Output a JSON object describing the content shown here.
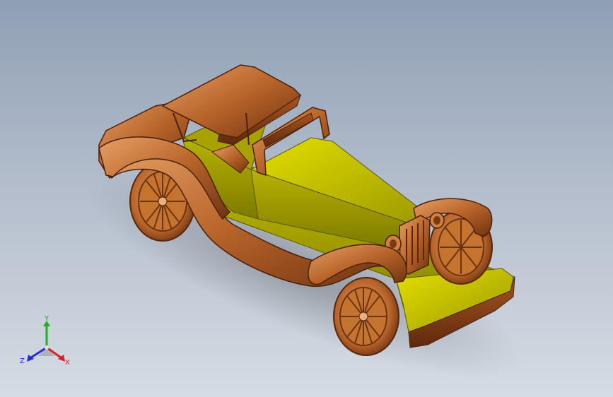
{
  "viewport": {
    "background_top": "#8f9fb4",
    "background_bottom": "#d6dce4"
  },
  "model": {
    "icon": "toy-car-3d-model",
    "colors": {
      "body_yellow": "#c9c400",
      "body_yellow_dark": "#8a8600",
      "wood_copper": "#b8642a",
      "wood_copper_dark": "#6e3310",
      "wood_copper_light": "#e09a5c"
    }
  },
  "triad": {
    "x_label": "X",
    "y_label": "Y",
    "z_label": "Z",
    "x_color": "#d42020",
    "y_color": "#1fb01f",
    "z_color": "#1f2fd4"
  }
}
